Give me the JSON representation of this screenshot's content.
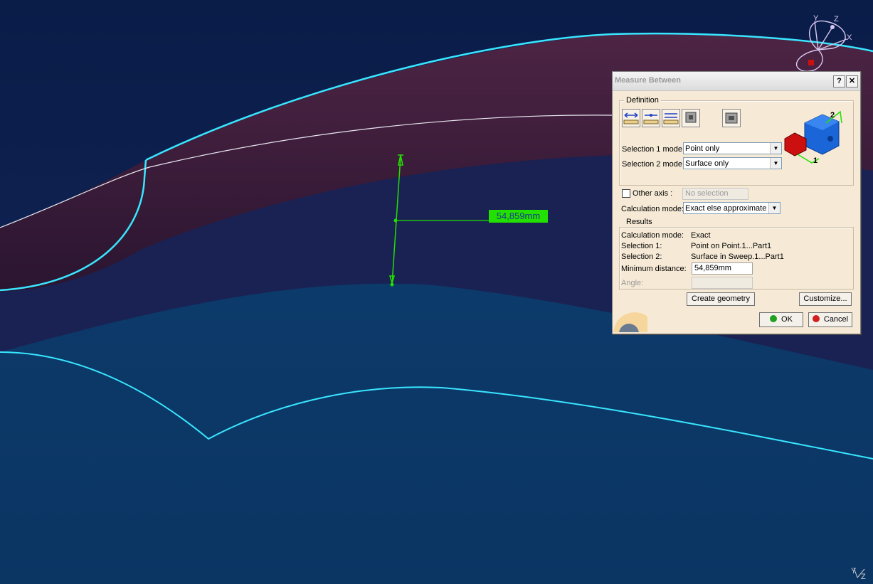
{
  "viewport": {
    "measure_value": "54,859mm",
    "compass_axes": {
      "y": "Y",
      "z": "Z",
      "x": "X"
    },
    "corner_axes": {
      "y": "Y",
      "z": "Z"
    }
  },
  "dialog": {
    "title": "Measure Between",
    "help_label": "?",
    "close_label": "✕",
    "definition": {
      "legend": "Definition",
      "tools": [
        "measure-between-icon",
        "measure-chain-icon",
        "measure-fan-icon",
        "measure-item-icon",
        "measure-thickness-icon"
      ],
      "selection1_label": "Selection 1 mode:",
      "selection1_value": "Point only",
      "selection2_label": "Selection 2 mode:",
      "selection2_value": "Surface only",
      "preview_labels": {
        "one": "1",
        "two": "2"
      },
      "other_axis_label": "Other axis :",
      "other_axis_value": "No selection",
      "other_axis_checked": false,
      "calc_label": "Calculation mode:",
      "calc_value": "Exact else approximate"
    },
    "results": {
      "legend": "Results",
      "calc_label": "Calculation mode:",
      "calc_value": "Exact",
      "sel1_label": "Selection 1:",
      "sel1_value": "Point on Point.1...Part1",
      "sel2_label": "Selection 2:",
      "sel2_value": "Surface in Sweep.1...Part1",
      "min_label": "Minimum distance:",
      "min_value": "54,859mm",
      "angle_label": "Angle:",
      "angle_value": ""
    },
    "create_geometry_label": "Create geometry",
    "customize_label": "Customize...",
    "ok_label": "OK",
    "cancel_label": "Cancel",
    "colors": {
      "cube_red": "#cc1010",
      "cube_blue": "#1a66d8",
      "accent_green": "#22e000",
      "edge_cyan": "#39e6ff"
    }
  }
}
